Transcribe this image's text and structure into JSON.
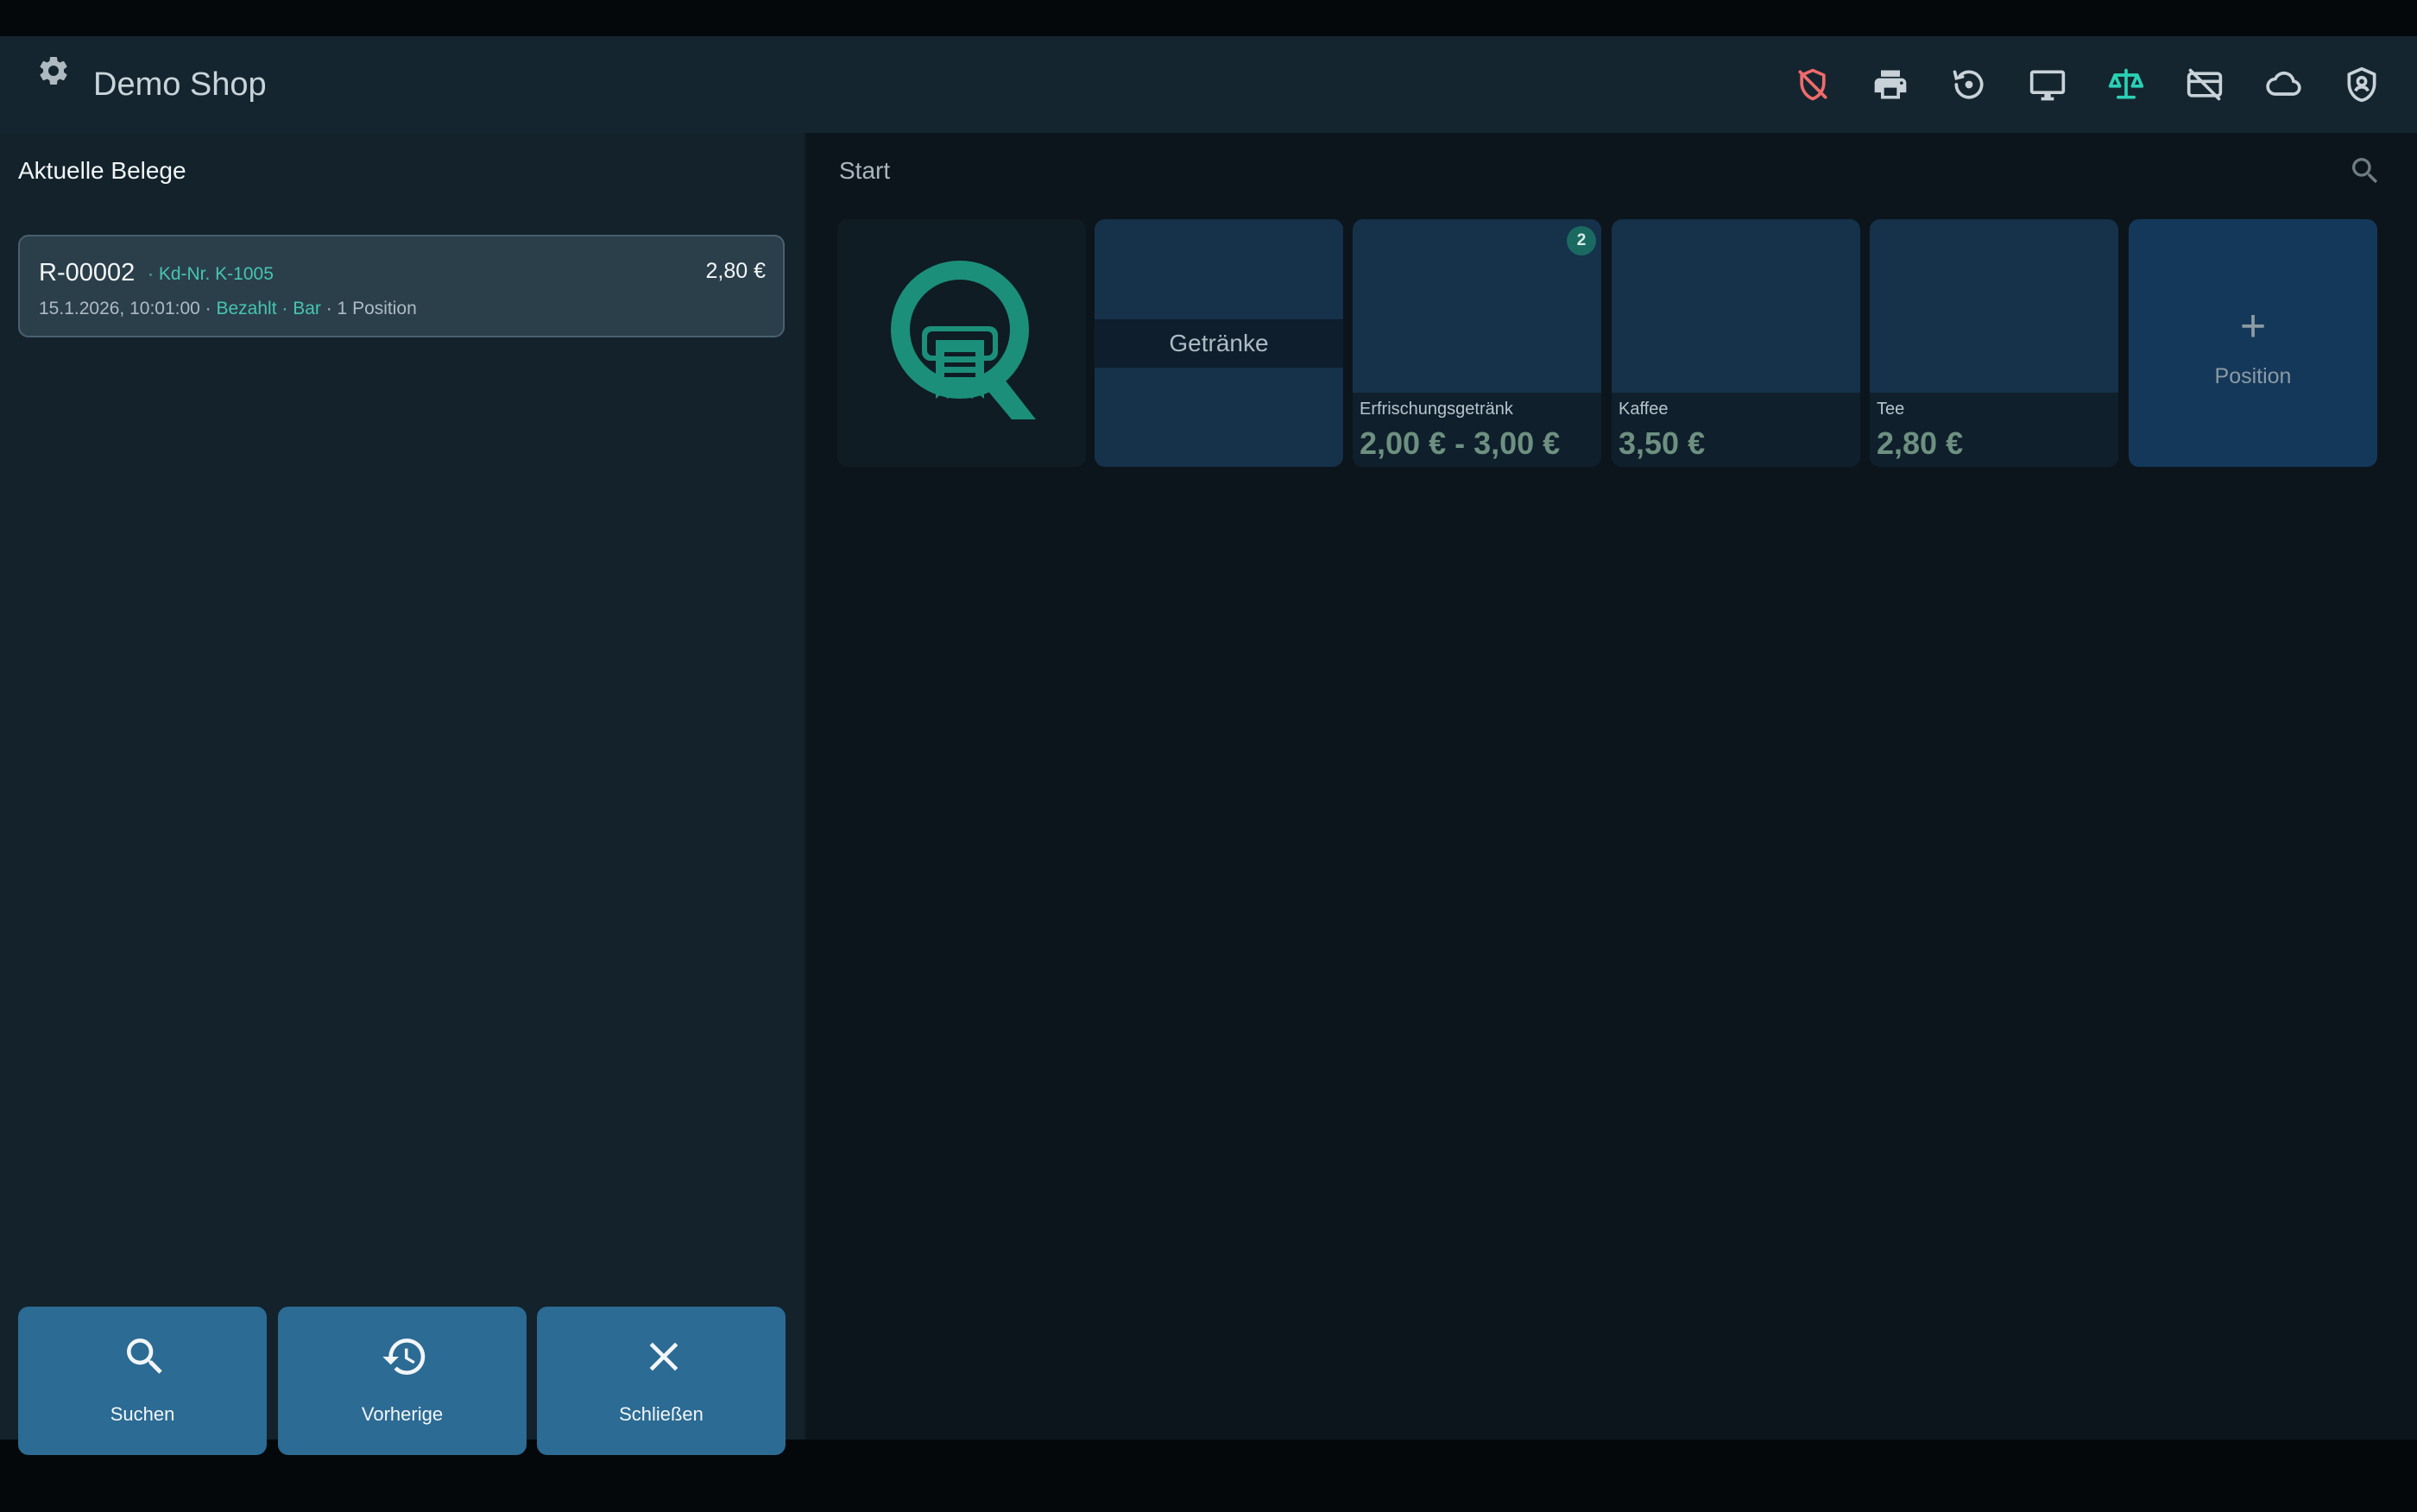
{
  "header": {
    "title": "Demo Shop",
    "icons": [
      "shield-off-icon",
      "printer-icon",
      "history-icon",
      "monitor-icon",
      "scale-icon",
      "card-off-icon",
      "cloud-icon",
      "user-shield-icon"
    ],
    "accent_color": "#2ad1b4",
    "warning_color": "#ef6b6b"
  },
  "left": {
    "section_title": "Aktuelle Belege",
    "receipt": {
      "number": "R-00002",
      "customer": "· Kd-Nr. K-1005",
      "amount": "2,80 €",
      "date": "15.1.2026, 10:01:00 · ",
      "status": "Bezahlt · Bar",
      "positions": " · 1 Position"
    },
    "buttons": {
      "search": "Suchen",
      "previous": "Vorherige",
      "close": "Schließen"
    }
  },
  "right": {
    "breadcrumb": "Start",
    "category_label": "Getränke",
    "products": [
      {
        "name": "Erfrischungsgetränk",
        "price": "2,00 € - 3,00 €",
        "badge": "2"
      },
      {
        "name": "Kaffee",
        "price": "3,50 €"
      },
      {
        "name": "Tee",
        "price": "2,80 €"
      }
    ],
    "add_tile": {
      "plus": "+",
      "label": "Position"
    }
  }
}
